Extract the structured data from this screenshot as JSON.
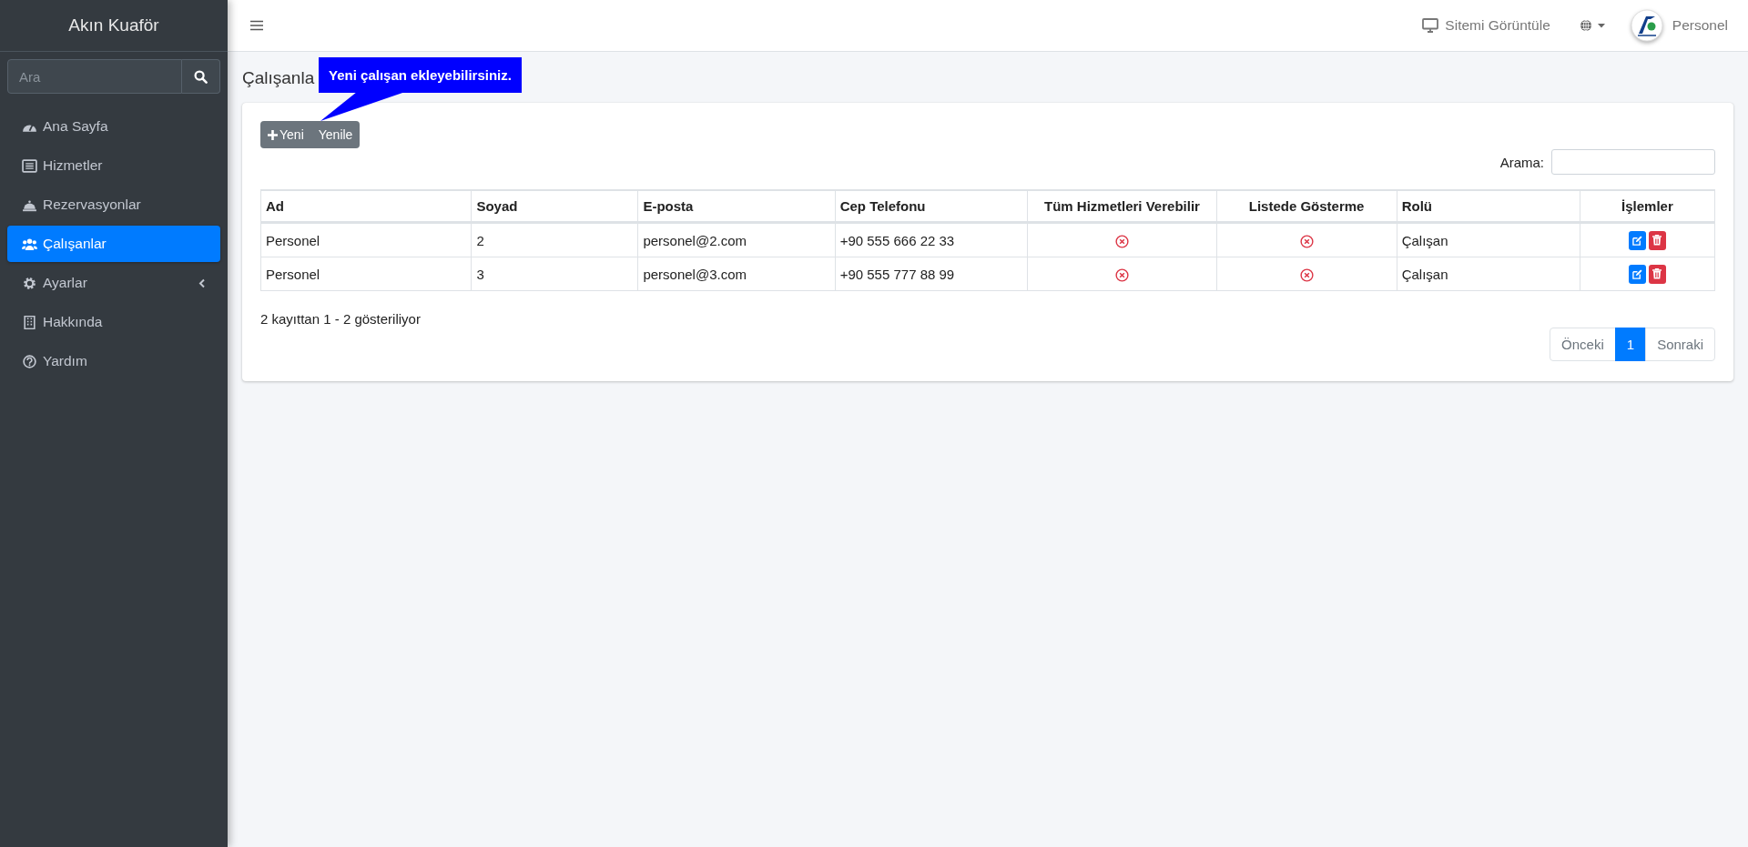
{
  "sidebar": {
    "brand": "Akın Kuaför",
    "search": {
      "placeholder": "Ara"
    },
    "items": [
      {
        "label": "Ana Sayfa",
        "selected": false
      },
      {
        "label": "Hizmetler",
        "selected": false
      },
      {
        "label": "Rezervasyonlar",
        "selected": false
      },
      {
        "label": "Çalışanlar",
        "selected": true
      },
      {
        "label": "Ayarlar",
        "selected": false,
        "expanded": false
      },
      {
        "label": "Hakkında",
        "selected": false
      },
      {
        "label": "Yardım",
        "selected": false
      }
    ]
  },
  "topbar": {
    "view_site": "Sitemi Görüntüle",
    "user": "Personel"
  },
  "page_title": "Çalışanla",
  "tooltip": "Yeni çalışan ekleyebilirsiniz.",
  "toolbar": {
    "buttons": [
      "Yeni",
      "Yenile"
    ]
  },
  "search": {
    "label": "Arama:"
  },
  "table": {
    "columns": [
      "Ad",
      "Soyad",
      "E-posta",
      "Cep Telefonu",
      "Tüm Hizmetleri Verebilir",
      "Listede Gösterme",
      "Rolü",
      "İşlemler"
    ],
    "rows": [
      {
        "ad": "Personel",
        "soyad": "2",
        "email": "personel@2.com",
        "phone": "+90 555 666 22 33",
        "all_services": false,
        "hidden_in_list": false,
        "role": "Çalışan"
      },
      {
        "ad": "Personel",
        "soyad": "3",
        "email": "personel@3.com",
        "phone": "+90 555 777 88 99",
        "all_services": false,
        "hidden_in_list": false,
        "role": "Çalışan"
      }
    ]
  },
  "info": "2 kayıttan 1 - 2 gösteriliyor",
  "pagination": [
    {
      "label": "Önceki",
      "selected": false
    },
    {
      "label": "1",
      "selected": true
    },
    {
      "label": "Sonraki",
      "selected": false
    }
  ]
}
